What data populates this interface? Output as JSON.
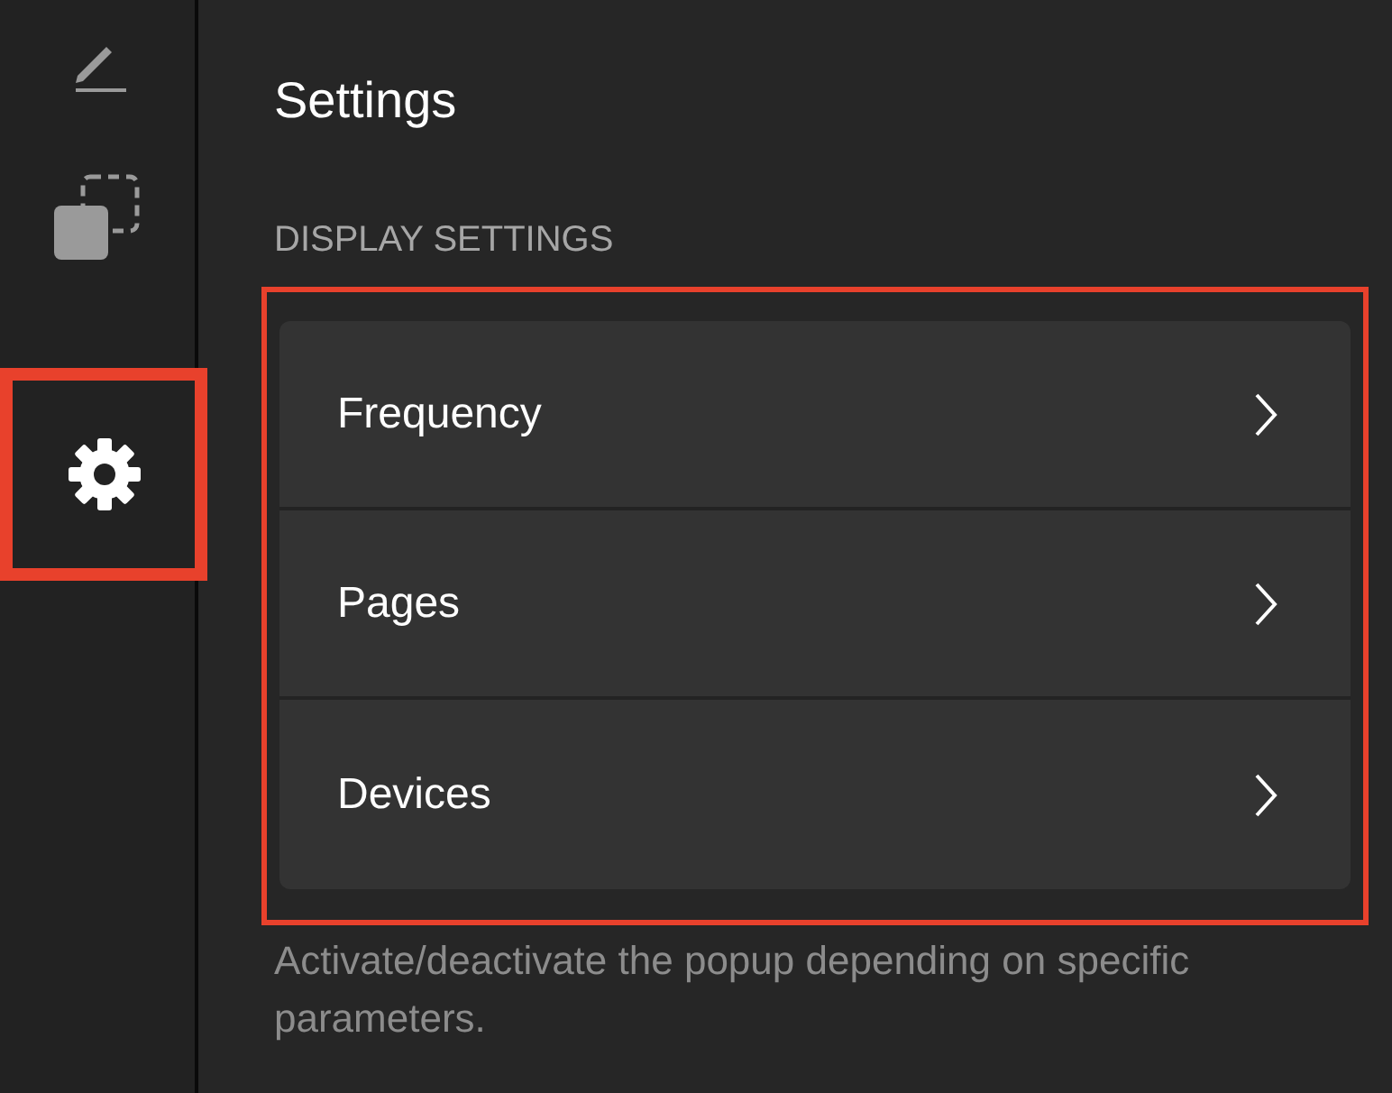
{
  "sidebar": {
    "items": [
      {
        "kind": "pencil",
        "selected": false,
        "highlighted": false
      },
      {
        "kind": "shapes",
        "selected": false,
        "highlighted": false
      },
      {
        "kind": "gear",
        "selected": true,
        "highlighted": true
      }
    ]
  },
  "title": "Settings",
  "section": {
    "heading": "DISPLAY SETTINGS",
    "highlighted": true,
    "items": [
      {
        "label": "Frequency"
      },
      {
        "label": "Pages"
      },
      {
        "label": "Devices"
      }
    ],
    "description": "Activate/deactivate the popup depending on specific parameters."
  }
}
